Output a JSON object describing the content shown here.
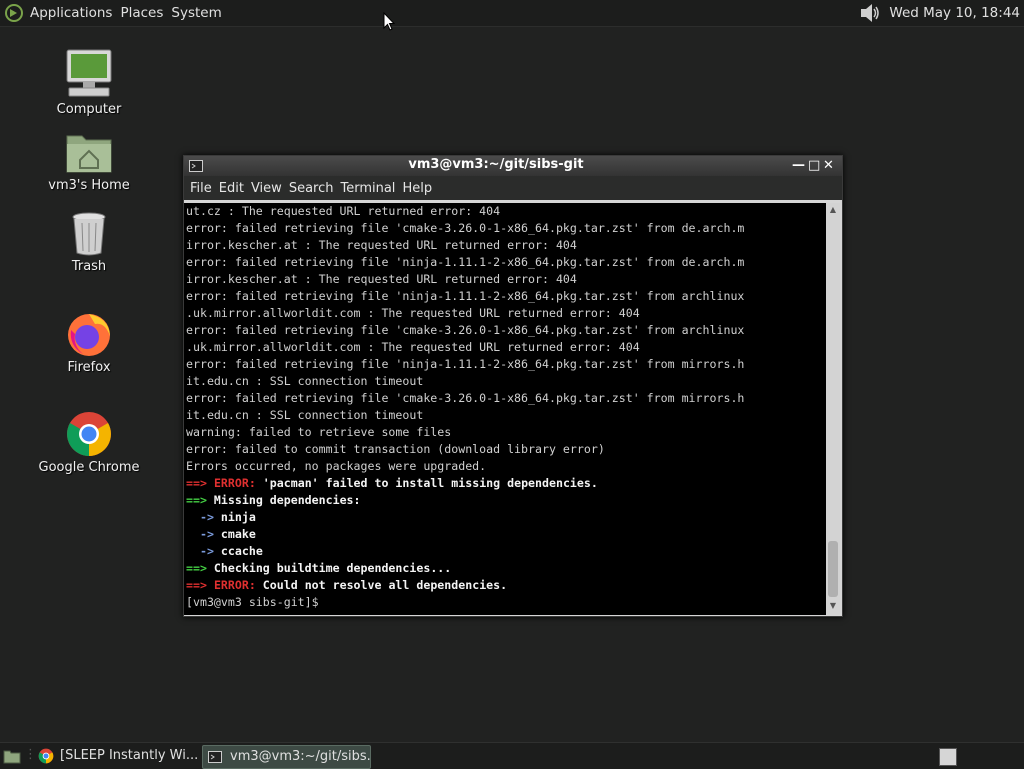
{
  "top_panel": {
    "menus": [
      "Applications",
      "Places",
      "System"
    ],
    "clock": "Wed May 10, 18:44"
  },
  "desktop_icons": [
    {
      "label": "Computer",
      "icon": "computer-icon"
    },
    {
      "label": "vm3's Home",
      "icon": "home-folder-icon"
    },
    {
      "label": "Trash",
      "icon": "trash-icon"
    },
    {
      "label": "Firefox",
      "icon": "firefox-icon"
    },
    {
      "label": "Google Chrome",
      "icon": "chrome-icon"
    }
  ],
  "terminal": {
    "title": "vm3@vm3:~/git/sibs-git",
    "menu": [
      "File",
      "Edit",
      "View",
      "Search",
      "Terminal",
      "Help"
    ],
    "lines": [
      "ut.cz : The requested URL returned error: 404",
      "error: failed retrieving file 'cmake-3.26.0-1-x86_64.pkg.tar.zst' from de.arch.m",
      "irror.kescher.at : The requested URL returned error: 404",
      "error: failed retrieving file 'ninja-1.11.1-2-x86_64.pkg.tar.zst' from de.arch.m",
      "irror.kescher.at : The requested URL returned error: 404",
      "error: failed retrieving file 'ninja-1.11.1-2-x86_64.pkg.tar.zst' from archlinux",
      ".uk.mirror.allworldit.com : The requested URL returned error: 404",
      "error: failed retrieving file 'cmake-3.26.0-1-x86_64.pkg.tar.zst' from archlinux",
      ".uk.mirror.allworldit.com : The requested URL returned error: 404",
      "error: failed retrieving file 'ninja-1.11.1-2-x86_64.pkg.tar.zst' from mirrors.h",
      "it.edu.cn : SSL connection timeout",
      "error: failed retrieving file 'cmake-3.26.0-1-x86_64.pkg.tar.zst' from mirrors.h",
      "it.edu.cn : SSL connection timeout",
      "warning: failed to retrieve some files",
      "error: failed to commit transaction (download library error)",
      "Errors occurred, no packages were upgraded."
    ],
    "colored": {
      "arrow": "==>",
      "sub_arrow": "->",
      "error_word": "ERROR:",
      "l1_text": " 'pacman' failed to install missing dependencies.",
      "l2_text": " Missing dependencies:",
      "deps": [
        "ninja",
        "cmake",
        "ccache"
      ],
      "l3_text": " Checking buildtime dependencies...",
      "l4_text": " Could not resolve all dependencies."
    },
    "prompt": "[vm3@vm3 sibs-git]$ "
  },
  "taskbar": {
    "tasks": [
      "[SLEEP Instantly Wi...",
      "vm3@vm3:~/git/sibs..."
    ]
  },
  "colors": {
    "desktop": "#212221",
    "error_red": "#e03030",
    "arrow_green": "#44d044",
    "dep_blue": "#7b9bdc"
  }
}
